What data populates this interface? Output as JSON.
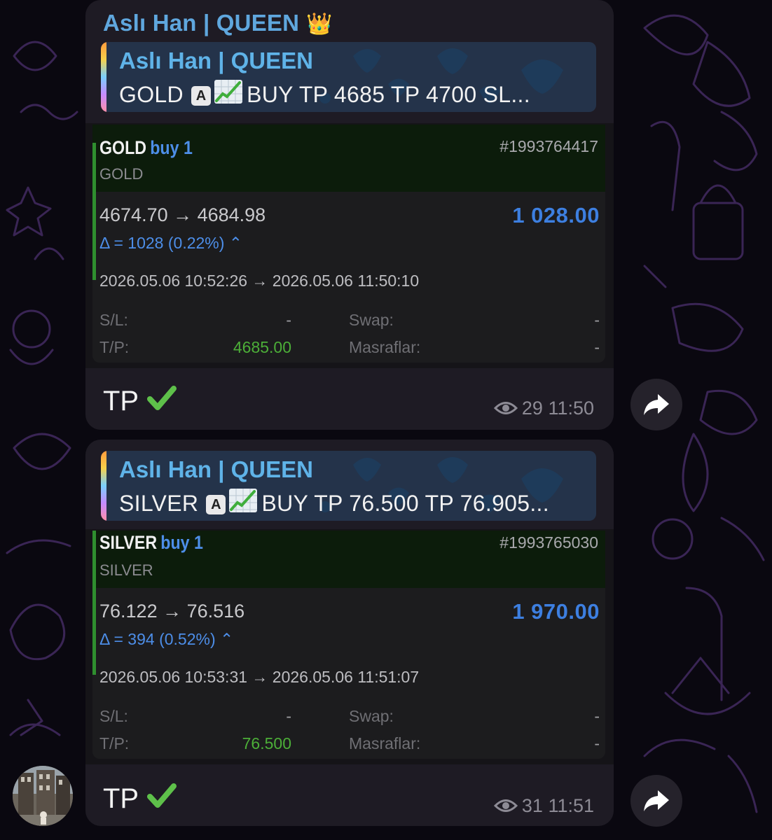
{
  "messages": [
    {
      "sender": "Aslı Han | QUEEN",
      "sender_emoji": "👑",
      "reply": {
        "title": "Aslı Han | QUEEN",
        "symbol": "GOLD",
        "key_emoji": "🅰",
        "chart_emoji": "📈",
        "text": "BUY TP 4685 TP 4700 SL..."
      },
      "position": {
        "symbol": "GOLD",
        "side": "buy 1",
        "ticket": "#1993764417",
        "subtitle": "GOLD",
        "prices": "4674.70 → 4684.98",
        "profit": "1 028.00",
        "delta": "Δ = 1028 (0.22%) ⌃",
        "times": "2026.05.06 10:52:26 → 2026.05.06 11:50:10",
        "sl_label": "S/L:",
        "sl_value": "-",
        "tp_label": "T/P:",
        "tp_value": "4685.00",
        "swap_label": "Swap:",
        "swap_value": "-",
        "fees_label": "Masraflar:",
        "fees_value": "-"
      },
      "caption": "TP",
      "caption_emoji": "✅",
      "views": "29",
      "time": "11:50"
    },
    {
      "reply": {
        "title": "Aslı Han | QUEEN",
        "symbol": "SILVER",
        "key_emoji": "🅰",
        "chart_emoji": "📈",
        "text": "BUY TP 76.500 TP 76.905..."
      },
      "position": {
        "symbol": "SILVER",
        "side": "buy 1",
        "ticket": "#1993765030",
        "subtitle": "SILVER",
        "prices": "76.122 → 76.516",
        "profit": "1 970.00",
        "delta": "Δ = 394 (0.52%) ⌃",
        "times": "2026.05.06 10:53:31 → 2026.05.06 11:51:07",
        "sl_label": "S/L:",
        "sl_value": "-",
        "tp_label": "T/P:",
        "tp_value": "76.500",
        "swap_label": "Swap:",
        "swap_value": "-",
        "fees_label": "Masraflar:",
        "fees_value": "-"
      },
      "caption": "TP",
      "caption_emoji": "✅",
      "views": "31",
      "time": "11:51"
    }
  ],
  "icons": {
    "views": "eye-icon",
    "forward": "forward-arrow-icon",
    "crown": "crown-icon",
    "check": "check-mark-icon"
  },
  "colors": {
    "sender_name": "#5fa7de",
    "profit": "#3d7fe0",
    "tp_value": "#4cae38",
    "bubble": "#1e1b24",
    "reply_bg": "#24334a"
  }
}
